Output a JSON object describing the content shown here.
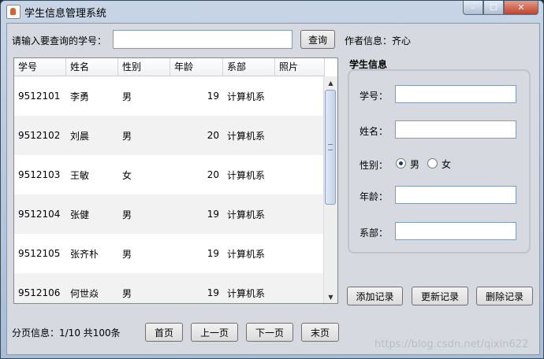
{
  "window": {
    "title": "学生信息管理系统",
    "controls": {
      "minimize": "–",
      "maximize": "☐",
      "close": "✕"
    }
  },
  "search": {
    "label": "请输入要查询的学号：",
    "value": "",
    "button": "查询"
  },
  "author": "作者信息：齐心",
  "table": {
    "columns": [
      "学号",
      "姓名",
      "性别",
      "年龄",
      "系部",
      "照片"
    ],
    "rows": [
      [
        "9512101",
        "李勇",
        "男",
        "19",
        "计算机系",
        ""
      ],
      [
        "9512102",
        "刘晨",
        "男",
        "20",
        "计算机系",
        ""
      ],
      [
        "9512103",
        "王敏",
        "女",
        "20",
        "计算机系",
        ""
      ],
      [
        "9512104",
        "张健",
        "男",
        "19",
        "计算机系",
        ""
      ],
      [
        "9512105",
        "张齐朴",
        "男",
        "19",
        "计算机系",
        ""
      ],
      [
        "9512106",
        "何世焱",
        "男",
        "19",
        "计算机系",
        ""
      ]
    ]
  },
  "form": {
    "title": "学生信息",
    "id_label": "学号：",
    "name_label": "姓名：",
    "gender_label": "性别：",
    "male": "男",
    "female": "女",
    "gender_selected": "男",
    "age_label": "年龄：",
    "dept_label": "系部：",
    "id_value": "",
    "name_value": "",
    "age_value": "",
    "dept_value": ""
  },
  "actions": {
    "add": "添加记录",
    "update": "更新记录",
    "delete": "删除记录"
  },
  "pagination": {
    "info": "分页信息：1/10 共100条",
    "first": "首页",
    "prev": "上一页",
    "next": "下一页",
    "last": "末页"
  },
  "watermark": "https://blog.csdn.net/qixin622"
}
